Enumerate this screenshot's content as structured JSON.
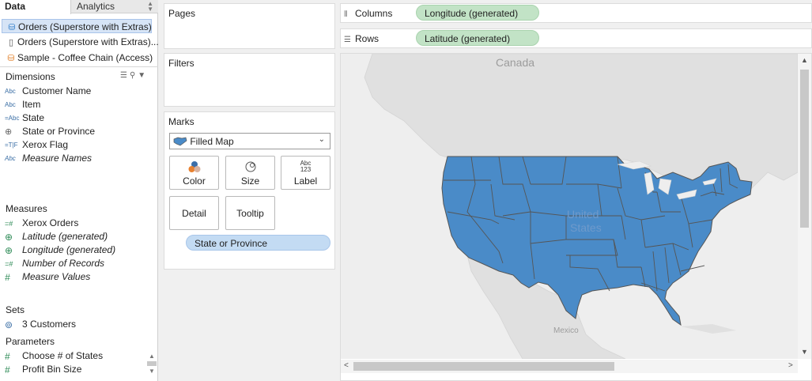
{
  "tabs": {
    "data": "Data",
    "analytics": "Analytics"
  },
  "data_sources": [
    {
      "name": "Orders (Superstore with Extras)",
      "selected": true
    },
    {
      "name": "Orders (Superstore with Extras)...",
      "selected": false
    },
    {
      "name": "Sample - Coffee Chain (Access)",
      "selected": false
    }
  ],
  "dimensions": {
    "title": "Dimensions",
    "items": [
      {
        "type": "Abc",
        "name": "Customer Name"
      },
      {
        "type": "Abc",
        "name": "Item"
      },
      {
        "type": "=Abc",
        "name": "State"
      },
      {
        "type": "globe",
        "name": "State or Province"
      },
      {
        "type": "=T|F",
        "name": "Xerox Flag"
      },
      {
        "type": "Abc",
        "name": "Measure Names"
      }
    ]
  },
  "measures": {
    "title": "Measures",
    "items": [
      {
        "type": "=#",
        "name": "Xerox Orders"
      },
      {
        "type": "globe",
        "name": "Latitude (generated)"
      },
      {
        "type": "globe",
        "name": "Longitude (generated)"
      },
      {
        "type": "=#",
        "name": "Number of Records"
      },
      {
        "type": "#",
        "name": "Measure Values"
      }
    ]
  },
  "sets": {
    "title": "Sets",
    "items": [
      "3 Customers"
    ]
  },
  "parameters": {
    "title": "Parameters",
    "items": [
      "Choose # of States",
      "Profit Bin Size"
    ]
  },
  "pages": {
    "title": "Pages"
  },
  "filters": {
    "title": "Filters"
  },
  "marks": {
    "title": "Marks",
    "type": "Filled Map",
    "buttons": {
      "color": "Color",
      "size": "Size",
      "label": "Label",
      "detail": "Detail",
      "tooltip": "Tooltip"
    },
    "label_icon_top": "Abc",
    "label_icon_bottom": "123",
    "detail_pill": "State or Province"
  },
  "columns": {
    "label": "Columns",
    "pill": "Longitude (generated)"
  },
  "rows": {
    "label": "Rows",
    "pill": "Latitude (generated)"
  },
  "map": {
    "labels": {
      "canada": "Canada",
      "us_line1": "United",
      "us_line2": "States",
      "mexico": "Mexico"
    },
    "land_color": "#e0e0e0",
    "state_fill": "#4a8bc8",
    "state_border": "#5a5a5a"
  }
}
